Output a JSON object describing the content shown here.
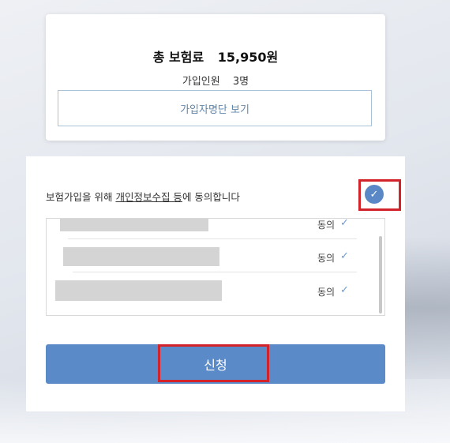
{
  "summary": {
    "total_label": "총 보험료",
    "total_value": "15,950원",
    "members_label": "가입인원",
    "members_value": "3명",
    "view_members_label": "가입자명단 보기"
  },
  "consent": {
    "text_prefix": "보험가입을 위해 ",
    "text_link": "개인정보수집 등",
    "text_suffix": "에 동의합니다",
    "check_all_icon": "check-circle-icon",
    "items": [
      {
        "label": "동의",
        "icon": "check-icon"
      },
      {
        "label": "동의",
        "icon": "check-icon"
      },
      {
        "label": "동의",
        "icon": "check-icon"
      }
    ]
  },
  "apply_label": "신청",
  "colors": {
    "accent": "#5a8bc8",
    "highlight": "#d2232a",
    "link_border": "#a8c3d9"
  }
}
